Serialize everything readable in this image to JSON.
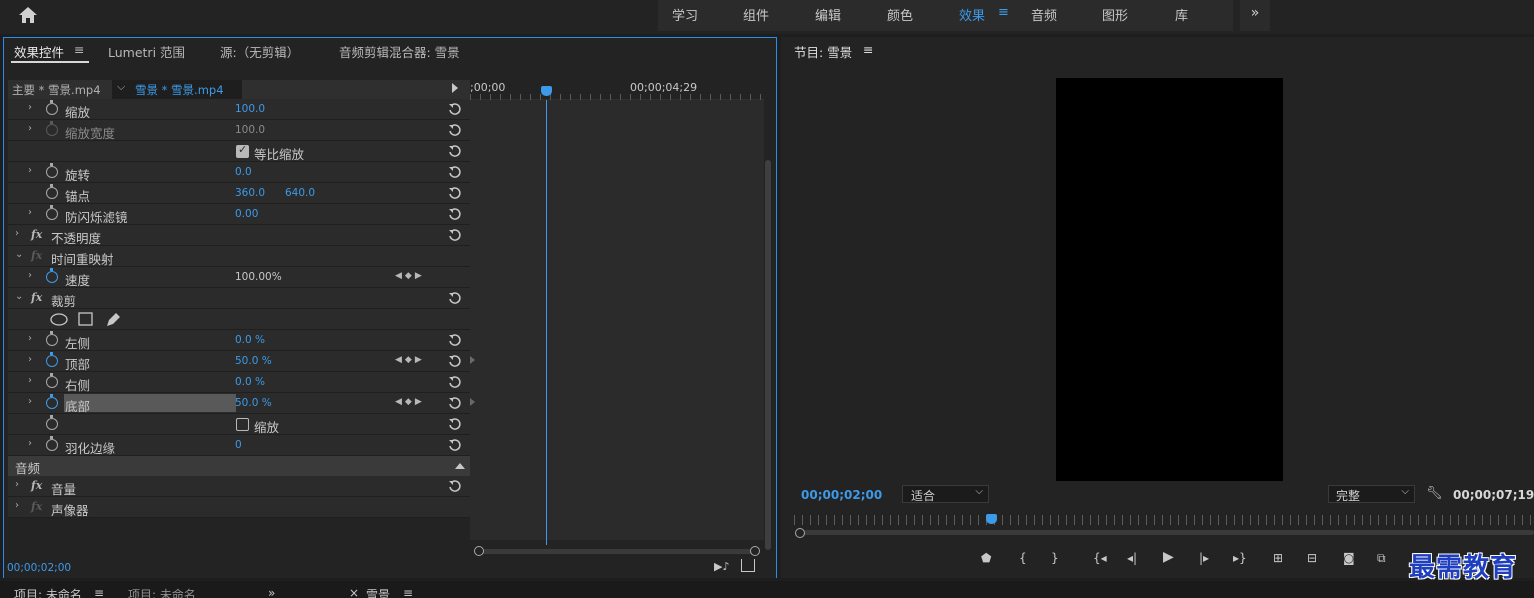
{
  "workspaces": {
    "tabs": [
      "学习",
      "组件",
      "编辑",
      "颜色",
      "效果",
      "音频",
      "图形",
      "库"
    ],
    "active": "效果",
    "more": "»"
  },
  "effect_controls": {
    "tabs": [
      "效果控件",
      "Lumetri 范围",
      "源:（无剪辑）",
      "音频剪辑混合器: 雪景"
    ],
    "master_clip": "主要 * 雪景.mp4",
    "sequence_clip": "雪景 * 雪景.mp4",
    "timeline_start": ";00;00",
    "timeline_end": "00;00;04;29",
    "rows": [
      {
        "name": "缩放",
        "value": "100.0"
      },
      {
        "name": "缩放宽度",
        "value": "100.0"
      },
      {
        "checkbox_label": "等比缩放",
        "checked": true
      },
      {
        "name": "旋转",
        "value": "0.0"
      },
      {
        "name": "锚点",
        "value": "360.0",
        "value2": "640.0"
      },
      {
        "name": "防闪烁滤镜",
        "value": "0.00"
      },
      {
        "effect": "不透明度"
      },
      {
        "effect": "时间重映射"
      },
      {
        "name": "速度",
        "value": "100.00%"
      },
      {
        "effect": "裁剪"
      },
      {
        "shapes": [
          "ellipse-mask",
          "rectangle-mask",
          "pen-mask"
        ]
      },
      {
        "name": "左侧",
        "value": "0.0 %"
      },
      {
        "name": "顶部",
        "value": "50.0 %"
      },
      {
        "name": "右侧",
        "value": "0.0 %"
      },
      {
        "name": "底部",
        "value": "50.0 %"
      },
      {
        "checkbox_label": "缩放",
        "checked": false
      },
      {
        "name": "羽化边缘",
        "value": "0"
      }
    ],
    "audio_section": "音频",
    "audio_effects": [
      "音量",
      "声像器"
    ],
    "current_time": "00;00;02;00"
  },
  "program_monitor": {
    "title": "节目: 雪景",
    "current_time": "00;00;02;00",
    "fit": "适合",
    "quality": "完整",
    "duration": "00;00;07;19"
  },
  "bottom_tabs": [
    "项目: 未命名",
    "项目: 未命名",
    "»",
    "×",
    "雪景"
  ],
  "watermark": "最需教育",
  "colors": {
    "accent": "#3d9ae8",
    "panel": "#232323",
    "row": "#2b2b2b"
  }
}
